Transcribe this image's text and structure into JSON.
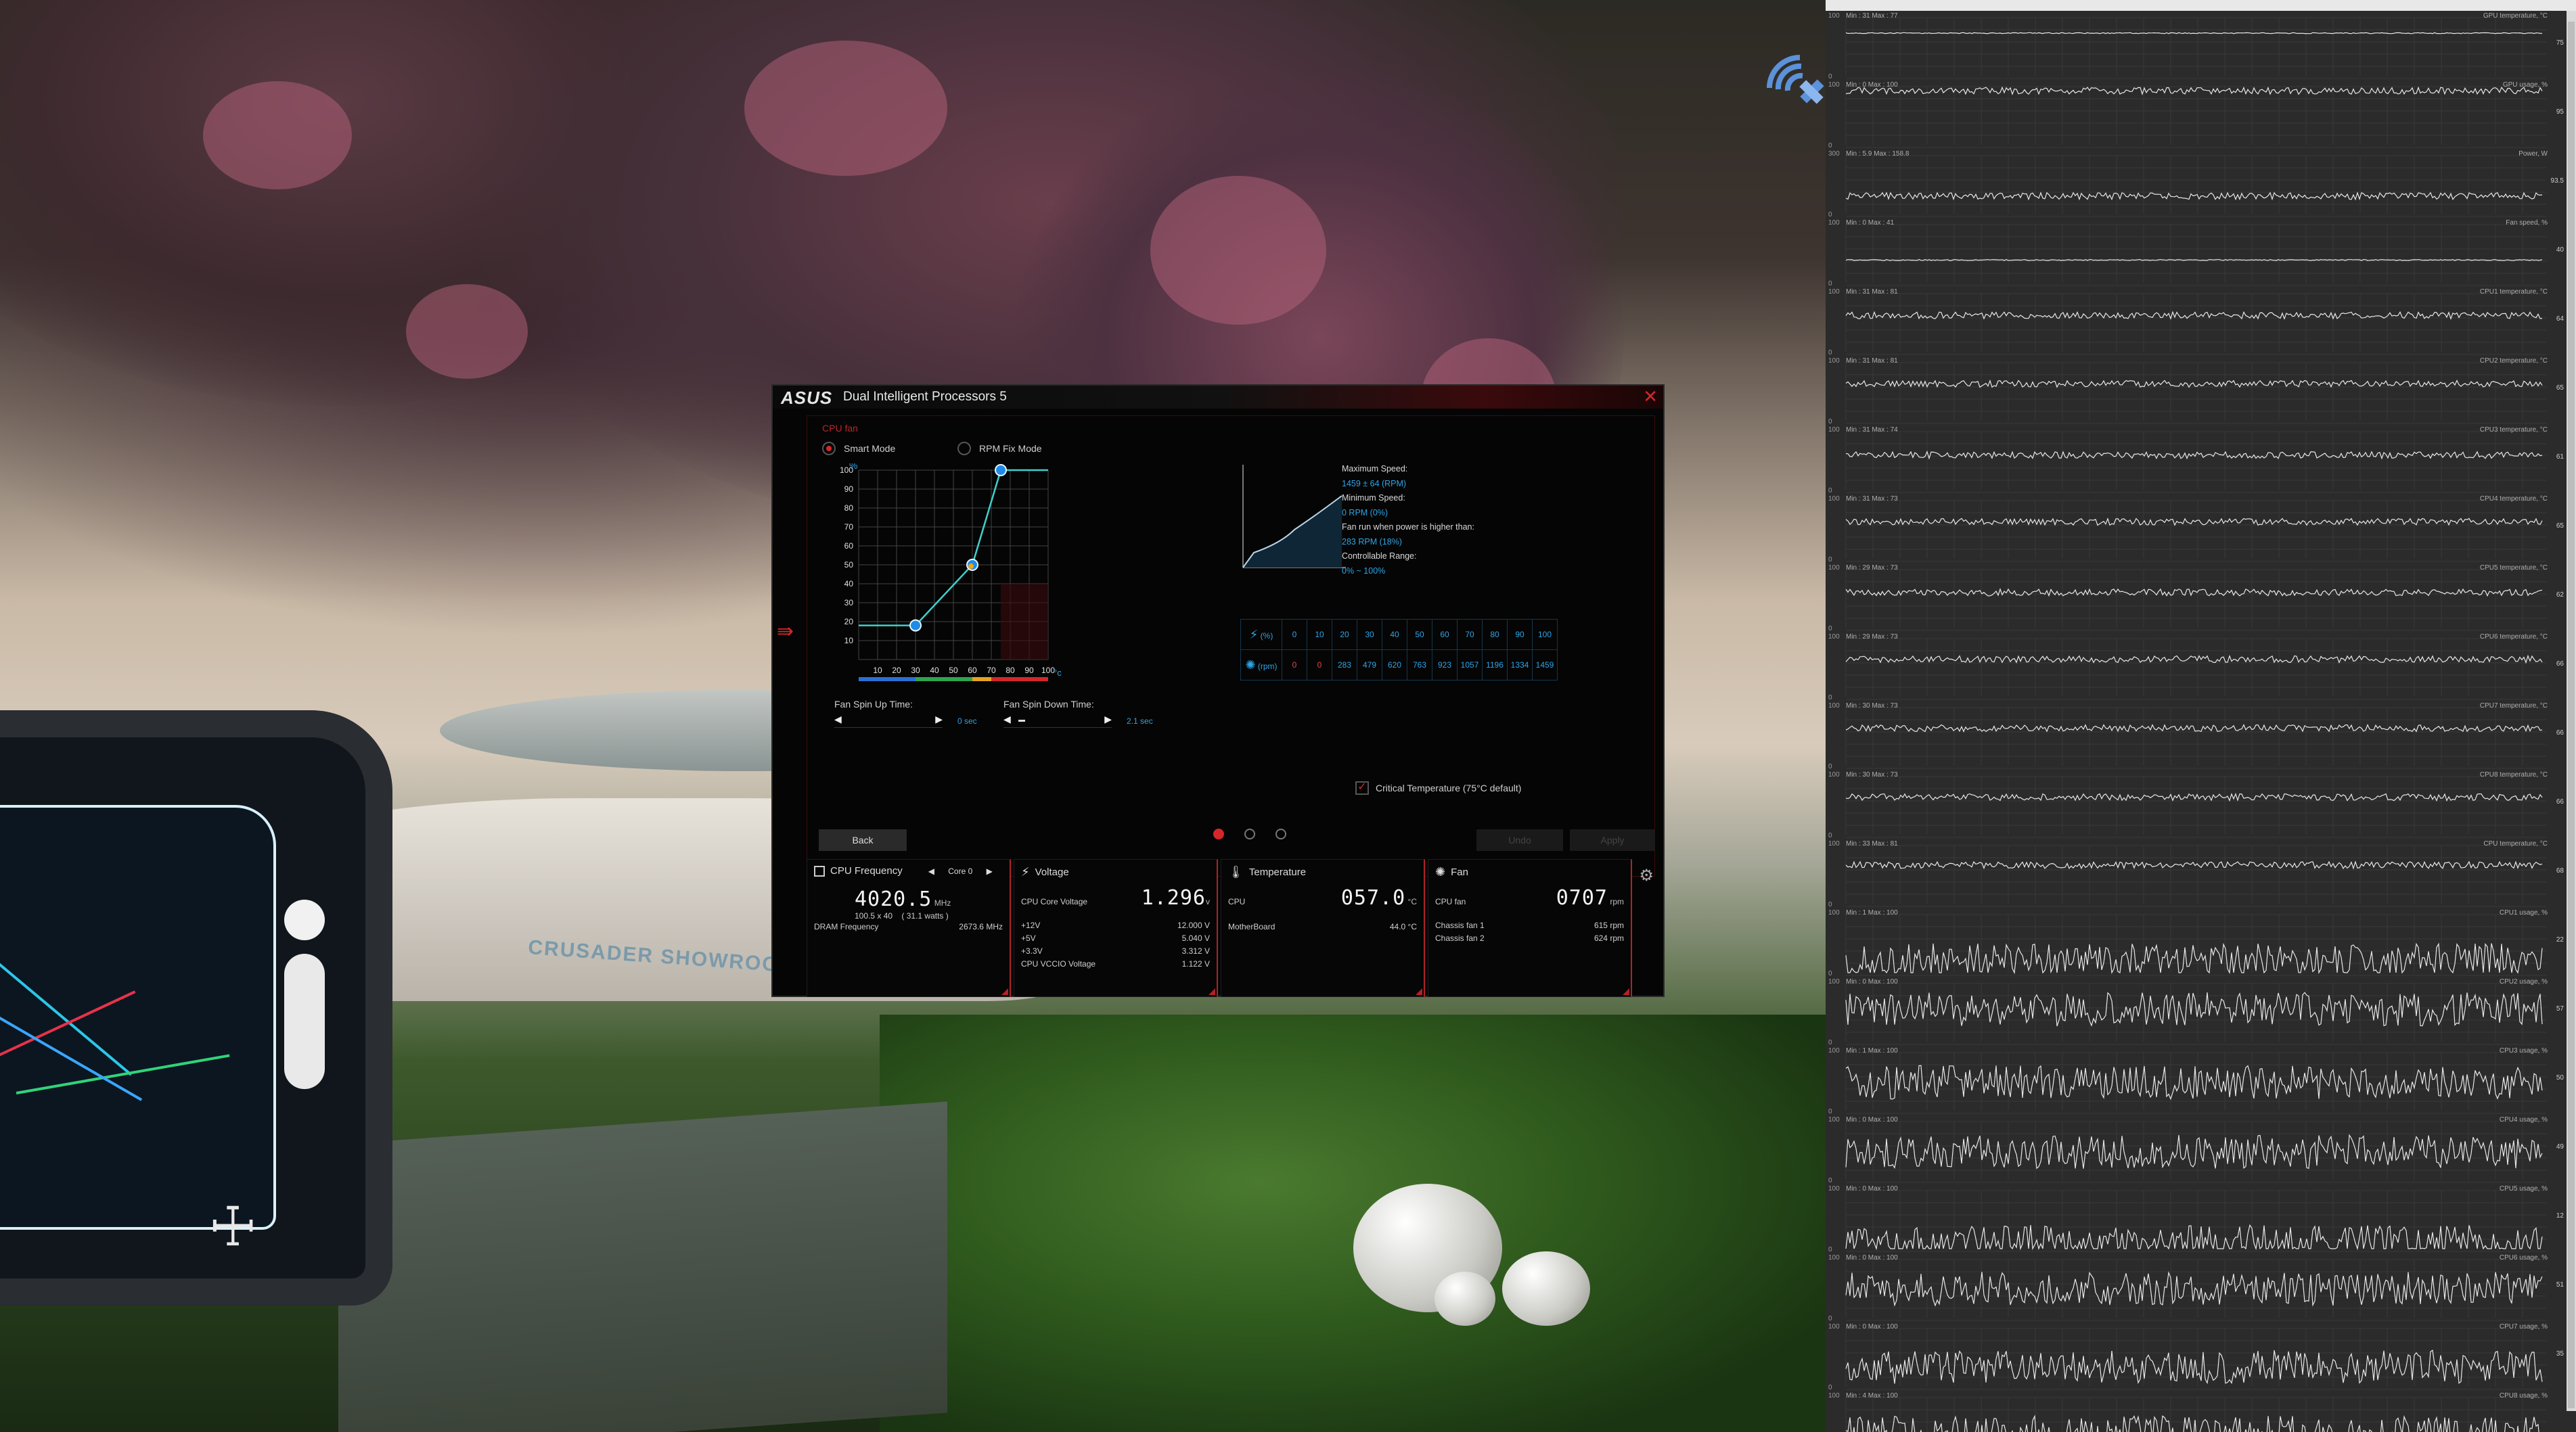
{
  "scene": {
    "showroom_sign": "CRUSADER SHOWROOM"
  },
  "dip5": {
    "brand": "ASUS",
    "title": "Dual Intelligent Processors 5",
    "section_label": "CPU fan",
    "modes": [
      {
        "label": "Smart Mode",
        "selected": true
      },
      {
        "label": "RPM Fix Mode",
        "selected": false
      }
    ],
    "graph": {
      "y_unit": "%",
      "x_unit": "°c",
      "y_ticks": [
        "100",
        "90",
        "80",
        "70",
        "60",
        "50",
        "40",
        "30",
        "20",
        "10"
      ],
      "x_ticks": [
        "10",
        "20",
        "30",
        "40",
        "50",
        "60",
        "70",
        "80",
        "90",
        "100"
      ],
      "points": [
        {
          "temp": 0,
          "pct": 18
        },
        {
          "temp": 30,
          "pct": 18
        },
        {
          "temp": 60,
          "pct": 50
        },
        {
          "temp": 75,
          "pct": 100
        },
        {
          "temp": 100,
          "pct": 100
        }
      ]
    },
    "spin_up": {
      "label": "Fan Spin Up Time:",
      "value": "0 sec"
    },
    "spin_down": {
      "label": "Fan Spin Down Time:",
      "value": "2.1 sec"
    },
    "speed_info": {
      "max_label": "Maximum Speed:",
      "max_value": "1459 ± 64 (RPM)",
      "min_label": "Minimum Speed:",
      "min_value": "0 RPM (0%)",
      "run_label": "Fan run when power is higher than:",
      "run_value": "283 RPM (18%)",
      "range_label": "Controllable Range:",
      "range_value": "0% ~ 100%"
    },
    "table": {
      "pct_unit": "(%)",
      "rpm_unit": "(rpm)",
      "pct": [
        "0",
        "10",
        "20",
        "30",
        "40",
        "50",
        "60",
        "70",
        "80",
        "90",
        "100"
      ],
      "rpm": [
        "0",
        "0",
        "283",
        "479",
        "620",
        "763",
        "923",
        "1057",
        "1196",
        "1334",
        "1459"
      ]
    },
    "critical_temp": "Critical Temperature (75°C default)",
    "buttons": {
      "back": "Back",
      "undo": "Undo",
      "apply": "Apply"
    },
    "monitors": {
      "cpu_freq": {
        "title": "CPU Frequency",
        "core_select": "Core 0",
        "value": "4020.5",
        "unit": "MHz",
        "detail": "100.5 x 40",
        "watts": "( 31.1 watts )",
        "dram_label": "DRAM Frequency",
        "dram_value": "2673.6",
        "dram_unit": "MHz"
      },
      "voltage": {
        "title": "Voltage",
        "core_label": "CPU Core Voltage",
        "core_value": "1.296",
        "core_unit": "v",
        "rows": [
          {
            "label": "+12V",
            "value": "12.000",
            "unit": "V"
          },
          {
            "label": "+5V",
            "value": "5.040",
            "unit": "V"
          },
          {
            "label": "+3.3V",
            "value": "3.312",
            "unit": "V"
          },
          {
            "label": "CPU VCCIO Voltage",
            "value": "1.122",
            "unit": "V"
          }
        ]
      },
      "temperature": {
        "title": "Temperature",
        "cpu_label": "CPU",
        "cpu_value": "057.0",
        "cpu_unit": "°C",
        "mb_label": "MotherBoard",
        "mb_value": "44.0 °C"
      },
      "fan": {
        "title": "Fan",
        "cpu_label": "CPU fan",
        "cpu_value": "0707",
        "cpu_unit": "rpm",
        "rows": [
          {
            "label": "Chassis fan 1",
            "value": "615",
            "unit": "rpm"
          },
          {
            "label": "Chassis fan 2",
            "value": "624",
            "unit": "rpm"
          }
        ]
      }
    }
  },
  "hwmon": {
    "graphs": [
      {
        "minmax": "Min : 31 Max : 77",
        "name": "GPU temperature, °C",
        "top": "100",
        "bottom": "0",
        "current": "75"
      },
      {
        "minmax": "Min : 0 Max : 100",
        "name": "GPU usage, %",
        "top": "100",
        "bottom": "0",
        "current": "95"
      },
      {
        "minmax": "Min : 5.9 Max : 158.8",
        "name": "Power, W",
        "top": "300",
        "bottom": "0",
        "current": "93.5"
      },
      {
        "minmax": "Min : 0 Max : 41",
        "name": "Fan speed, %",
        "top": "100",
        "bottom": "0",
        "current": "40"
      },
      {
        "minmax": "Min : 31 Max : 81",
        "name": "CPU1 temperature, °C",
        "top": "100",
        "bottom": "0",
        "current": "64"
      },
      {
        "minmax": "Min : 31 Max : 81",
        "name": "CPU2 temperature, °C",
        "top": "100",
        "bottom": "0",
        "current": "65"
      },
      {
        "minmax": "Min : 31 Max : 74",
        "name": "CPU3 temperature, °C",
        "top": "100",
        "bottom": "0",
        "current": "61"
      },
      {
        "minmax": "Min : 31 Max : 73",
        "name": "CPU4 temperature, °C",
        "top": "100",
        "bottom": "0",
        "current": "65"
      },
      {
        "minmax": "Min : 29 Max : 73",
        "name": "CPU5 temperature, °C",
        "top": "100",
        "bottom": "0",
        "current": "62"
      },
      {
        "minmax": "Min : 29 Max : 73",
        "name": "CPU6 temperature, °C",
        "top": "100",
        "bottom": "0",
        "current": "66"
      },
      {
        "minmax": "Min : 30 Max : 73",
        "name": "CPU7 temperature, °C",
        "top": "100",
        "bottom": "0",
        "current": "66"
      },
      {
        "minmax": "Min : 30 Max : 73",
        "name": "CPU8 temperature, °C",
        "top": "100",
        "bottom": "0",
        "current": "66"
      },
      {
        "minmax": "Min : 33 Max : 81",
        "name": "CPU temperature, °C",
        "top": "100",
        "bottom": "0",
        "current": "68"
      },
      {
        "minmax": "Min : 1 Max : 100",
        "name": "CPU1 usage, %",
        "top": "100",
        "bottom": "0",
        "current": "22"
      },
      {
        "minmax": "Min : 0 Max : 100",
        "name": "CPU2 usage, %",
        "top": "100",
        "bottom": "0",
        "current": "57"
      },
      {
        "minmax": "Min : 1 Max : 100",
        "name": "CPU3 usage, %",
        "top": "100",
        "bottom": "0",
        "current": "50"
      },
      {
        "minmax": "Min : 0 Max : 100",
        "name": "CPU4 usage, %",
        "top": "100",
        "bottom": "0",
        "current": "49"
      },
      {
        "minmax": "Min : 0 Max : 100",
        "name": "CPU5 usage, %",
        "top": "100",
        "bottom": "0",
        "current": "12"
      },
      {
        "minmax": "Min : 0 Max : 100",
        "name": "CPU6 usage, %",
        "top": "100",
        "bottom": "0",
        "current": "51"
      },
      {
        "minmax": "Min : 0 Max : 100",
        "name": "CPU7 usage, %",
        "top": "100",
        "bottom": "0",
        "current": "35"
      },
      {
        "minmax": "Min : 4 Max : 100",
        "name": "CPU8 usage, %",
        "top": "100",
        "bottom": "0",
        "current": ""
      }
    ]
  }
}
